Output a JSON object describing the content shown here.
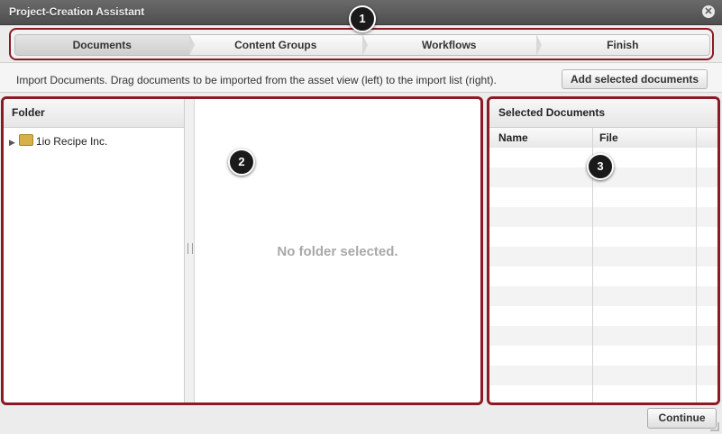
{
  "window": {
    "title": "Project-Creation Assistant",
    "close_icon": "close-icon"
  },
  "wizard": {
    "steps": [
      {
        "label": "Documents",
        "active": true
      },
      {
        "label": "Content Groups",
        "active": false
      },
      {
        "label": "Workflows",
        "active": false
      },
      {
        "label": "Finish",
        "active": false
      }
    ]
  },
  "badges": [
    "1",
    "2",
    "3"
  ],
  "instructions": {
    "text": "Import Documents. Drag documents to be imported from the asset view (left) to the import list (right).",
    "add_button": "Add selected documents"
  },
  "folder_pane": {
    "header": "Folder",
    "tree": [
      {
        "label": "1io Recipe Inc.",
        "expanded": false
      }
    ]
  },
  "asset_view": {
    "empty_text": "No folder selected."
  },
  "selected_documents": {
    "header": "Selected Documents",
    "columns": [
      "Name",
      "File"
    ],
    "rows": []
  },
  "footer": {
    "continue_label": "Continue"
  },
  "colors": {
    "accent_border": "#8b1a22",
    "title_bar": "#5a5a5a"
  }
}
